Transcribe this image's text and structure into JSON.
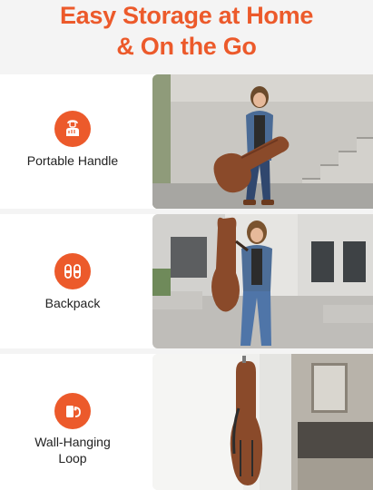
{
  "header": {
    "title_line1": "Easy Storage at Home",
    "title_line2": "& On the Go"
  },
  "features": [
    {
      "label": "Portable Handle",
      "icon": "hand-holding-case-icon"
    },
    {
      "label": "Backpack",
      "icon": "backpack-straps-icon"
    },
    {
      "label_line1": "Wall-Hanging",
      "label_line2": "Loop",
      "icon": "hanging-loop-icon"
    }
  ],
  "colors": {
    "accent": "#ec5a2b",
    "case_brown": "#8a4a2a"
  }
}
